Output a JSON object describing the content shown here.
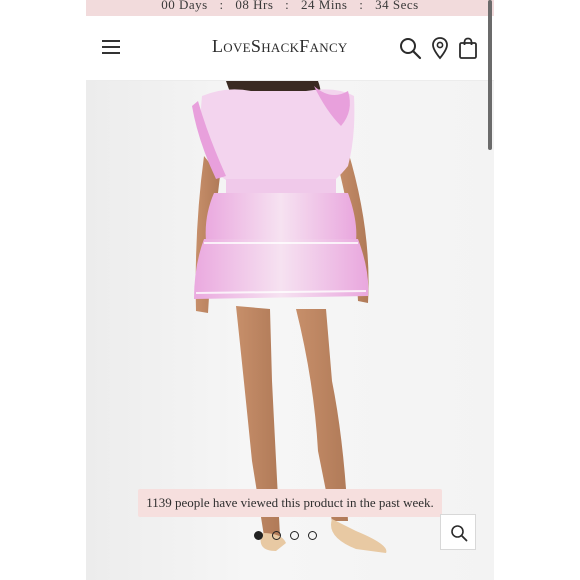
{
  "countdown": {
    "days": "00 Days",
    "hours": "08 Hrs",
    "mins": "24 Mins",
    "secs": "34 Secs",
    "separator": ":"
  },
  "header": {
    "logo": "LoveShackFancy",
    "icons": [
      "menu-icon",
      "search-icon",
      "location-pin-icon",
      "shopping-bag-icon"
    ]
  },
  "product": {
    "viewed_notice": "1139 people have viewed this product in the past week.",
    "carousel": {
      "total": 4,
      "active_index": 0
    }
  },
  "colors": {
    "banner_bg": "#f6dfde",
    "countdown_bg": "#f2dbdc",
    "dress_pink": "#e9a7de"
  }
}
